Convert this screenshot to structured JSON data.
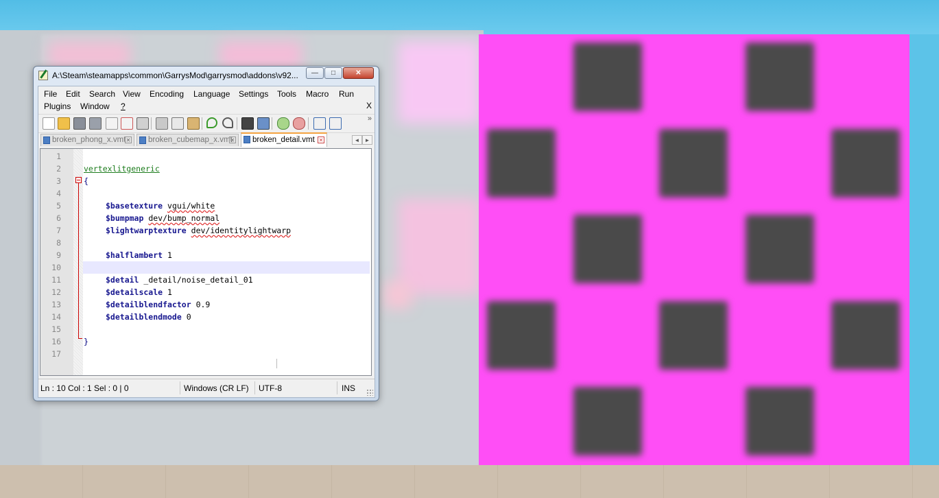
{
  "window": {
    "title": "A:\\Steam\\steamapps\\common\\GarrysMod\\garrysmod\\addons\\v92...",
    "minimize_glyph": "—",
    "maximize_glyph": "□",
    "close_glyph": "✕"
  },
  "menu": {
    "items": [
      "File",
      "Edit",
      "Search",
      "View",
      "Encoding",
      "Language",
      "Settings",
      "Tools",
      "Macro",
      "Run",
      "Plugins",
      "Window",
      "?"
    ],
    "close_doc": "X"
  },
  "toolbar": {
    "icons": [
      "new-file-icon",
      "open-file-icon",
      "save-icon",
      "save-all-icon",
      "close-icon",
      "close-all-icon",
      "print-icon",
      "cut-icon",
      "copy-icon",
      "paste-icon",
      "undo-icon",
      "redo-icon",
      "find-icon",
      "replace-icon",
      "zoom-in-icon",
      "zoom-out-icon",
      "sync-vertical-icon",
      "sync-horizontal-icon"
    ],
    "more": "»"
  },
  "tabs": [
    {
      "label": "broken_phong_x.vmt",
      "active": false
    },
    {
      "label": "broken_cubemap_x.vmt",
      "active": false
    },
    {
      "label": "broken_detail.vmt",
      "active": true
    }
  ],
  "tab_nav": {
    "prev": "◄",
    "next": "►"
  },
  "editor": {
    "current_line": 10,
    "lines": [
      {
        "n": "1",
        "text": ""
      },
      {
        "n": "2",
        "text": "vertexlitgeneric"
      },
      {
        "n": "3",
        "text": "{"
      },
      {
        "n": "4",
        "text": ""
      },
      {
        "n": "5",
        "key": "$basetexture",
        "val": "vgui/white"
      },
      {
        "n": "6",
        "key": "$bumpmap",
        "val": "dev/bump_normal"
      },
      {
        "n": "7",
        "key": "$lightwarptexture",
        "val": "dev/identitylightwarp"
      },
      {
        "n": "8",
        "text": ""
      },
      {
        "n": "9",
        "key": "$halflambert",
        "val": "1"
      },
      {
        "n": "10",
        "text": ""
      },
      {
        "n": "11",
        "key": "$detail",
        "val": "_detail/noise_detail_01"
      },
      {
        "n": "12",
        "key": "$detailscale",
        "val": "1"
      },
      {
        "n": "13",
        "key": "$detailblendfactor",
        "val": "0.9"
      },
      {
        "n": "14",
        "key": "$detailblendmode",
        "val": "0"
      },
      {
        "n": "15",
        "text": ""
      },
      {
        "n": "16",
        "text": "}"
      },
      {
        "n": "17",
        "text": ""
      }
    ]
  },
  "status": {
    "position": "Ln : 10    Col : 1    Sel : 0 | 0",
    "eol": "Windows (CR LF)",
    "encoding": "UTF-8",
    "mode": "INS"
  },
  "colors": {
    "checker_magenta": "#ff4ef6",
    "checker_dark": "#4a4a4a",
    "sky": "#5cc3e8",
    "tab_accent": "#f4a340"
  }
}
